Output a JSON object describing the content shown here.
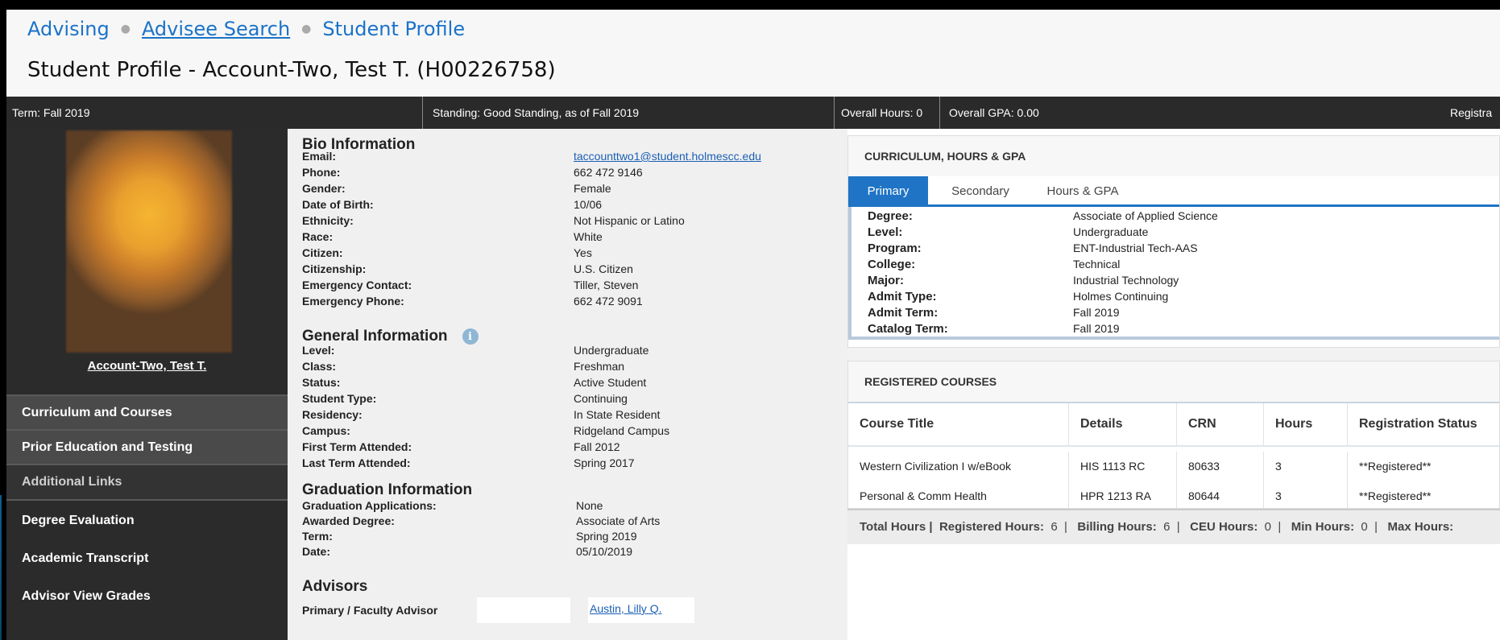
{
  "breadcrumb": {
    "items": [
      "Advising",
      "Advisee Search",
      "Student Profile"
    ]
  },
  "page_title": "Student Profile - Account-Two, Test T. (H00226758)",
  "status_bar": {
    "term": "Term: Fall 2019",
    "standing": "Standing: Good Standing, as of Fall 2019",
    "overall_hours": "Overall Hours: 0",
    "overall_gpa": "Overall GPA: 0.00",
    "registration": "Registra"
  },
  "sidebar": {
    "student_name": "Account-Two, Test T.",
    "nav": {
      "curriculum": "Curriculum and Courses",
      "prior_education": "Prior Education and Testing",
      "additional_links": "Additional Links",
      "degree_evaluation": "Degree Evaluation",
      "academic_transcript": "Academic Transcript",
      "advisor_view_grades": "Advisor View Grades"
    }
  },
  "bio": {
    "title": "Bio Information",
    "fields": [
      {
        "label": "Email:",
        "value": "taccounttwo1@student.holmescc.edu"
      },
      {
        "label": "Phone:",
        "value": "662 472 9146"
      },
      {
        "label": "Gender:",
        "value": "Female"
      },
      {
        "label": "Date of Birth:",
        "value": "10/06"
      },
      {
        "label": "Ethnicity:",
        "value": "Not Hispanic or Latino"
      },
      {
        "label": "Race:",
        "value": "White"
      },
      {
        "label": "Citizen:",
        "value": "Yes"
      },
      {
        "label": "Citizenship:",
        "value": "U.S. Citizen"
      },
      {
        "label": "Emergency Contact:",
        "value": "Tiller, Steven"
      },
      {
        "label": "Emergency Phone:",
        "value": "662 472 9091"
      }
    ]
  },
  "general": {
    "title": "General Information",
    "fields": [
      {
        "label": "Level:",
        "value": "Undergraduate"
      },
      {
        "label": "Class:",
        "value": "Freshman"
      },
      {
        "label": "Status:",
        "value": "Active Student"
      },
      {
        "label": "Student Type:",
        "value": "Continuing"
      },
      {
        "label": "Residency:",
        "value": "In State Resident"
      },
      {
        "label": "Campus:",
        "value": "Ridgeland Campus"
      },
      {
        "label": "First Term Attended:",
        "value": "Fall 2012"
      },
      {
        "label": "Last Term Attended:",
        "value": "Spring 2017"
      }
    ]
  },
  "graduation": {
    "title": "Graduation Information",
    "fields": [
      {
        "label": "Graduation Applications:",
        "value": "None"
      },
      {
        "label": "Awarded Degree:",
        "value": "Associate of Arts"
      },
      {
        "label": "Term:",
        "value": "Spring 2019"
      },
      {
        "label": "Date:",
        "value": "05/10/2019"
      }
    ]
  },
  "advisors": {
    "title": "Advisors",
    "label": "Primary / Faculty Advisor",
    "value": "Austin, Lilly Q."
  },
  "curriculum_card": {
    "title": "CURRICULUM, HOURS & GPA",
    "tabs": [
      "Primary",
      "Secondary",
      "Hours & GPA"
    ],
    "active_tab": "Primary",
    "fields": [
      {
        "label": "Degree:",
        "value": "Associate of Applied Science"
      },
      {
        "label": "Level:",
        "value": "Undergraduate"
      },
      {
        "label": "Program:",
        "value": "ENT-Industrial Tech-AAS"
      },
      {
        "label": "College:",
        "value": "Technical"
      },
      {
        "label": "Major:",
        "value": "Industrial Technology"
      },
      {
        "label": "Admit Type:",
        "value": "Holmes Continuing"
      },
      {
        "label": "Admit Term:",
        "value": "Fall 2019"
      },
      {
        "label": "Catalog Term:",
        "value": "Fall 2019"
      }
    ]
  },
  "courses_card": {
    "title": "REGISTERED COURSES",
    "columns": [
      "Course Title",
      "Details",
      "CRN",
      "Hours",
      "Registration Status"
    ],
    "rows": [
      [
        "Western Civilization I w/eBook",
        "HIS 1113 RC",
        "80633",
        "3",
        "**Registered**"
      ],
      [
        "Personal & Comm Health",
        "HPR 1213 RA",
        "80644",
        "3",
        "**Registered**"
      ]
    ],
    "totals": {
      "total_hours": "Total Hours |",
      "registered_label": "Registered Hours:",
      "registered_value": "6",
      "billing_label": "Billing Hours:",
      "billing_value": "6",
      "ceu_label": "CEU Hours:",
      "ceu_value": "0",
      "min_label": "Min Hours:",
      "min_value": "0",
      "max_label": "Max Hours:"
    }
  },
  "colors": {
    "link": "#1a73c9",
    "status_bar": "#2a2a2a",
    "sidebar": "#2b2b2b",
    "tab_active": "#1f74c5"
  }
}
